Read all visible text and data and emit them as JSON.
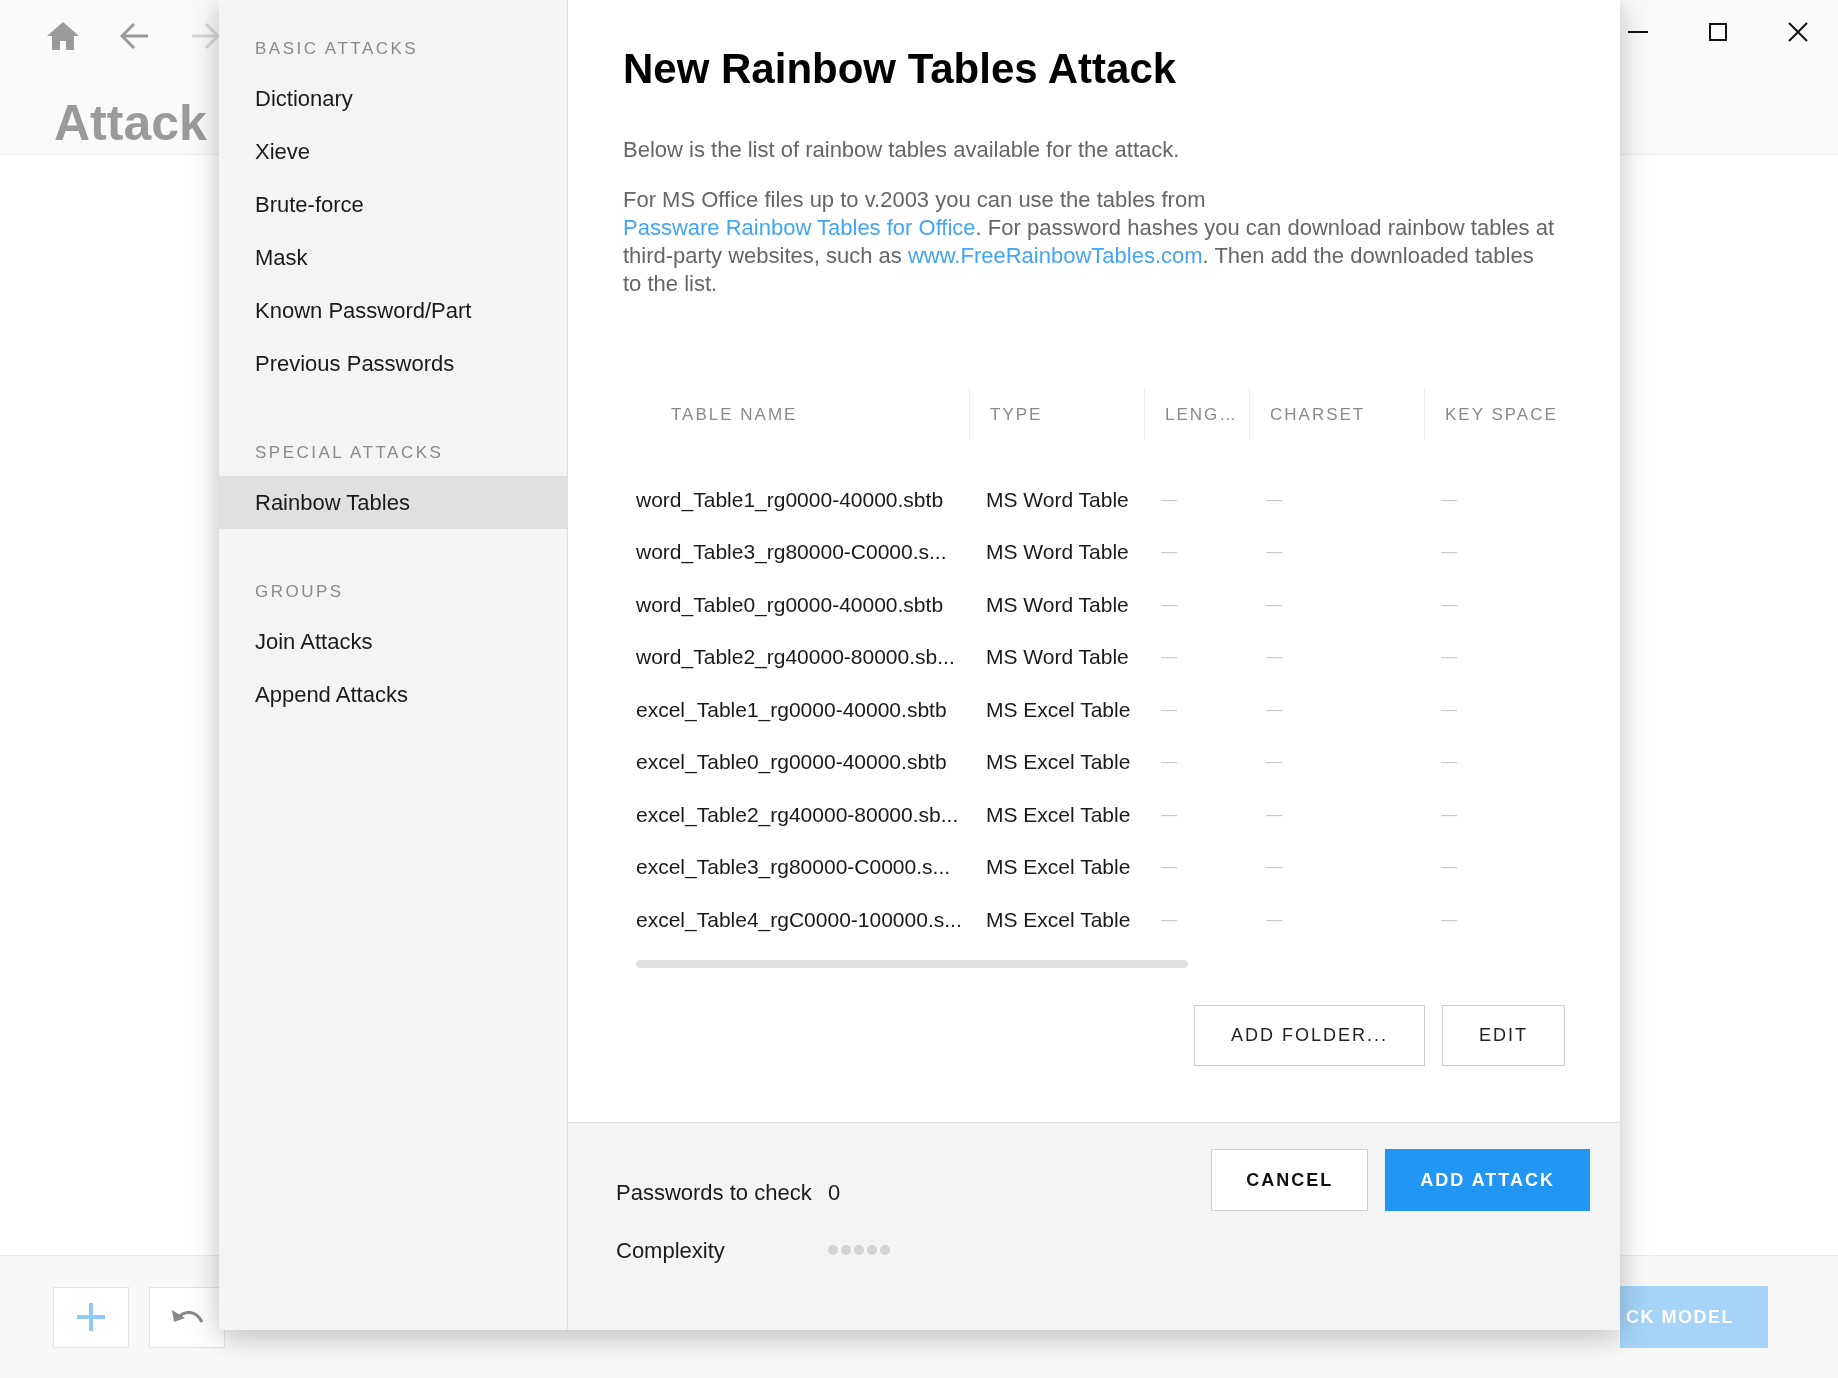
{
  "background": {
    "title": "Attack",
    "action_button": "CK MODEL"
  },
  "sidebar": {
    "sections": [
      {
        "heading": "BASIC ATTACKS",
        "items": [
          {
            "label": "Dictionary",
            "selected": false
          },
          {
            "label": "Xieve",
            "selected": false
          },
          {
            "label": "Brute-force",
            "selected": false
          },
          {
            "label": "Mask",
            "selected": false
          },
          {
            "label": "Known Password/Part",
            "selected": false
          },
          {
            "label": "Previous Passwords",
            "selected": false
          }
        ]
      },
      {
        "heading": "SPECIAL ATTACKS",
        "items": [
          {
            "label": "Rainbow Tables",
            "selected": true
          }
        ]
      },
      {
        "heading": "GROUPS",
        "items": [
          {
            "label": "Join Attacks",
            "selected": false
          },
          {
            "label": "Append Attacks",
            "selected": false
          }
        ]
      }
    ]
  },
  "dialog": {
    "title": "New Rainbow Tables Attack",
    "intro": "Below is the list of rainbow tables available for the attack.",
    "note": [
      {
        "kind": "text",
        "text": "For MS Office files up to v.2003 you can use the tables from "
      },
      {
        "kind": "link",
        "text": "Passware Rainbow Tables for Office"
      },
      {
        "kind": "text",
        "text": ". For password hashes you can download rainbow tables at third-party websites, such as "
      },
      {
        "kind": "link",
        "text": "www.FreeRainbowTables.com"
      },
      {
        "kind": "text",
        "text": ". Then add the downloaded tables to the list."
      }
    ],
    "table": {
      "columns": [
        "TABLE NAME",
        "TYPE",
        "LENG…",
        "CHARSET",
        "KEY SPACE"
      ],
      "rows": [
        [
          "word_Table1_rg0000-40000.sbtb",
          "MS Word Table",
          "—",
          "—",
          "—"
        ],
        [
          "word_Table3_rg80000-C0000.s...",
          "MS Word Table",
          "—",
          "—",
          "—"
        ],
        [
          "word_Table0_rg0000-40000.sbtb",
          "MS Word Table",
          "—",
          "—",
          "—"
        ],
        [
          "word_Table2_rg40000-80000.sb...",
          "MS Word Table",
          "—",
          "—",
          "—"
        ],
        [
          "excel_Table1_rg0000-40000.sbtb",
          "MS Excel Table",
          "—",
          "—",
          "—"
        ],
        [
          "excel_Table0_rg0000-40000.sbtb",
          "MS Excel Table",
          "—",
          "—",
          "—"
        ],
        [
          "excel_Table2_rg40000-80000.sb...",
          "MS Excel Table",
          "—",
          "—",
          "—"
        ],
        [
          "excel_Table3_rg80000-C0000.s...",
          "MS Excel Table",
          "—",
          "—",
          "—"
        ],
        [
          "excel_Table4_rgC0000-100000.s...",
          "MS Excel Table",
          "—",
          "—",
          "—"
        ]
      ]
    },
    "table_buttons": [
      "ADD FOLDER...",
      "EDIT"
    ],
    "footer": {
      "passwords_label": "Passwords to check",
      "passwords_value": "0",
      "complexity_label": "Complexity",
      "stars": 0,
      "buttons": [
        {
          "label": "CANCEL",
          "kind": "secondary"
        },
        {
          "label": "ADD ATTACK",
          "kind": "primary"
        }
      ]
    }
  }
}
